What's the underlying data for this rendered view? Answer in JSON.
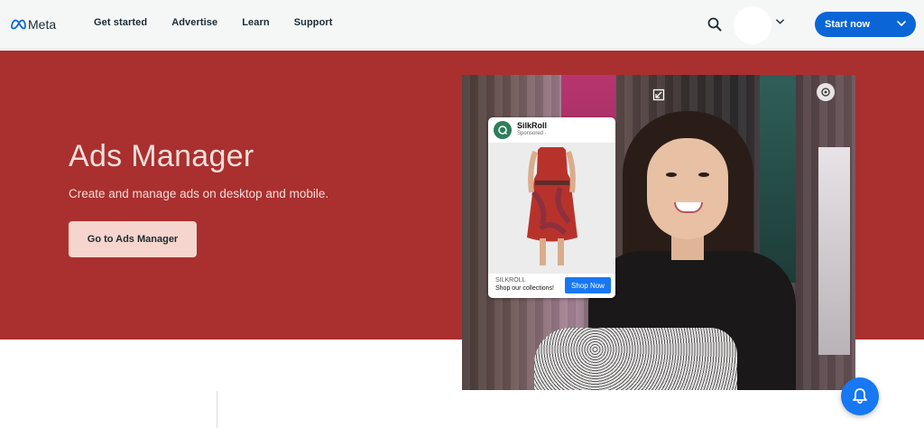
{
  "header": {
    "logo_text": "Meta",
    "nav": [
      {
        "label": "Get started"
      },
      {
        "label": "Advertise"
      },
      {
        "label": "Learn"
      },
      {
        "label": "Support"
      }
    ],
    "start_button_label": "Start now"
  },
  "hero": {
    "title": "Ads Manager",
    "subtitle": "Create and manage ads on desktop and mobile.",
    "cta_label": "Go to Ads Manager"
  },
  "ad": {
    "brand": "SilkRoll",
    "sponsored": "Sponsored · ",
    "site": "SILKROLL",
    "description": "Shop our collections!",
    "button_label": "Shop Now"
  },
  "colors": {
    "hero_bg": "#a9302f",
    "primary_blue": "#0a66d6",
    "cta_bg": "#f5d5cd"
  },
  "icons": [
    "meta-logo-icon",
    "search-icon",
    "chevron-down-icon",
    "minimize-icon",
    "accessibility-icon",
    "bell-icon"
  ]
}
